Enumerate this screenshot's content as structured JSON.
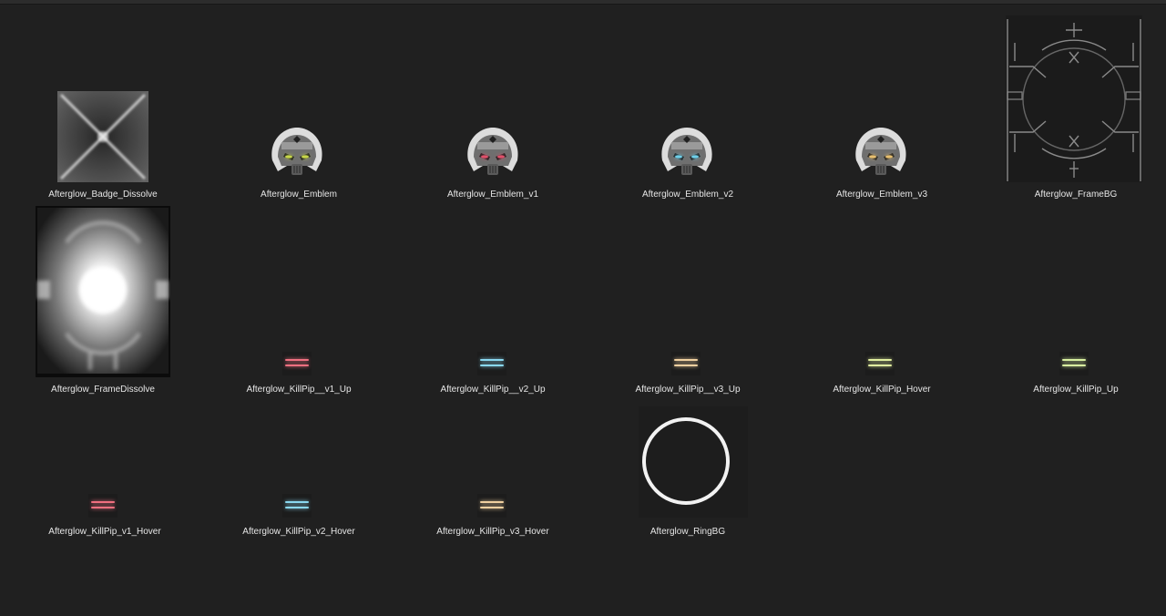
{
  "assets": [
    {
      "name": "Afterglow_Badge_Dissolve",
      "kind": "badge-dissolve"
    },
    {
      "name": "Afterglow_Emblem",
      "kind": "emblem",
      "eye_color": "#c8d84a"
    },
    {
      "name": "Afterglow_Emblem_v1",
      "kind": "emblem",
      "eye_color": "#e0506a"
    },
    {
      "name": "Afterglow_Emblem_v2",
      "kind": "emblem",
      "eye_color": "#6fd0ea"
    },
    {
      "name": "Afterglow_Emblem_v3",
      "kind": "emblem",
      "eye_color": "#e8c070"
    },
    {
      "name": "Afterglow_FrameBG",
      "kind": "frame-bg"
    },
    {
      "name": "Afterglow_FrameDissolve",
      "kind": "frame-dissolve"
    },
    {
      "name": "Afterglow_KillPip__v1_Up",
      "kind": "killpip",
      "color": "#f07080"
    },
    {
      "name": "Afterglow_KillPip__v2_Up",
      "kind": "killpip",
      "color": "#8ad8f0"
    },
    {
      "name": "Afterglow_KillPip__v3_Up",
      "kind": "killpip",
      "color": "#f0d0a0"
    },
    {
      "name": "Afterglow_KillPip_Hover",
      "kind": "killpip",
      "color": "#e2f0a0"
    },
    {
      "name": "Afterglow_KillPip_Up",
      "kind": "killpip",
      "color": "#d8f0a0"
    },
    {
      "name": "Afterglow_KillPip_v1_Hover",
      "kind": "killpip",
      "color": "#f07080"
    },
    {
      "name": "Afterglow_KillPip_v2_Hover",
      "kind": "killpip",
      "color": "#8ad8f0"
    },
    {
      "name": "Afterglow_KillPip_v3_Hover",
      "kind": "killpip",
      "color": "#f0d0a0"
    },
    {
      "name": "Afterglow_RingBG",
      "kind": "ring-bg"
    }
  ]
}
